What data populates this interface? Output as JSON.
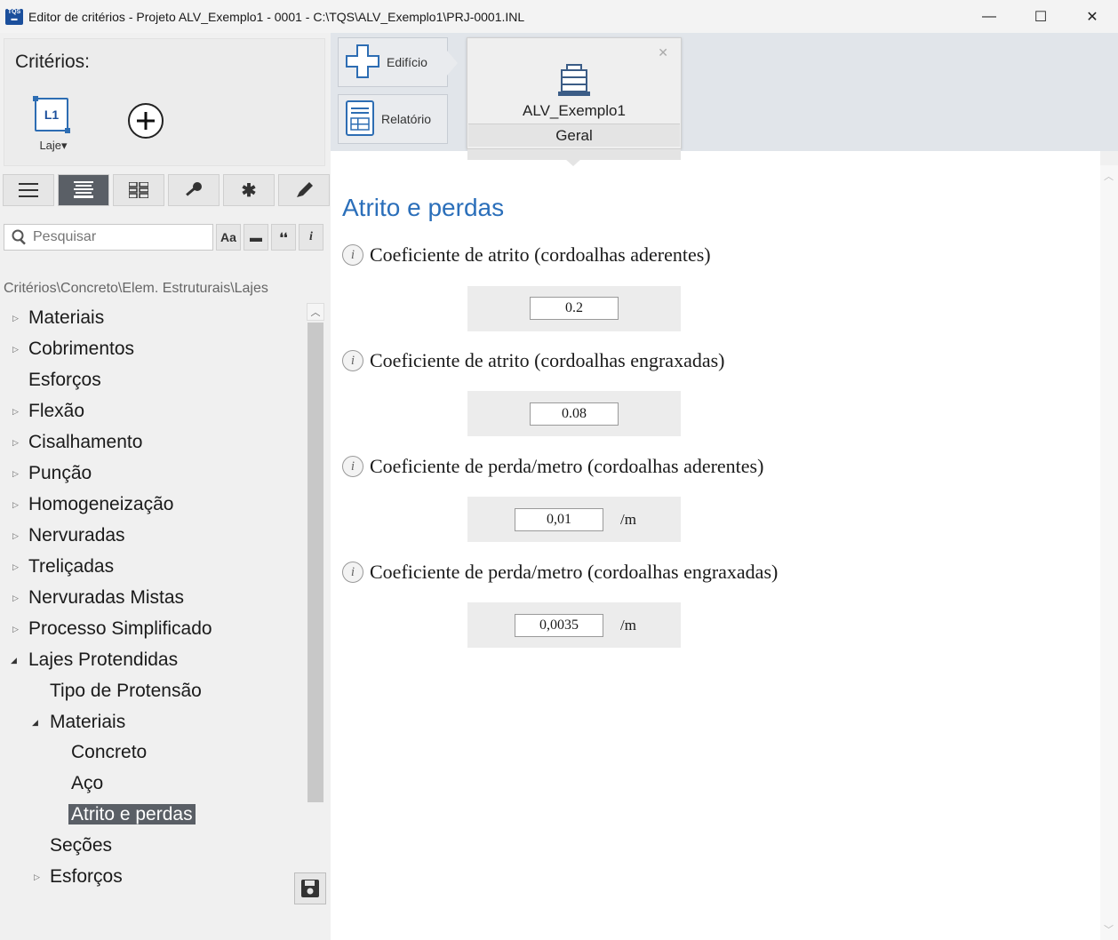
{
  "window": {
    "title": "Editor de critérios - Projeto ALV_Exemplo1 - 0001 - C:\\TQS\\ALV_Exemplo1\\PRJ-0001.INL",
    "app_icon_text_top": "TQS",
    "minimize": "—",
    "maximize": "☐",
    "close": "✕"
  },
  "left": {
    "criterios_label": "Critérios:",
    "laje_icon_text": "L1",
    "laje_caption": "Laje▾",
    "search_placeholder": "Pesquisar",
    "search_buttons": [
      "Aa",
      "▬",
      "❛❛",
      "i"
    ],
    "breadcrumb": "Critérios\\Concreto\\Elem. Estruturais\\Lajes",
    "tree": [
      {
        "label": "Materiais",
        "level": 0,
        "arrow": "▷"
      },
      {
        "label": "Cobrimentos",
        "level": 0,
        "arrow": "▷"
      },
      {
        "label": "Esforços",
        "level": 0,
        "arrow": ""
      },
      {
        "label": "Flexão",
        "level": 0,
        "arrow": "▷"
      },
      {
        "label": "Cisalhamento",
        "level": 0,
        "arrow": "▷"
      },
      {
        "label": "Punção",
        "level": 0,
        "arrow": "▷"
      },
      {
        "label": "Homogeneização",
        "level": 0,
        "arrow": "▷"
      },
      {
        "label": "Nervuradas",
        "level": 0,
        "arrow": "▷"
      },
      {
        "label": "Treliçadas",
        "level": 0,
        "arrow": "▷"
      },
      {
        "label": "Nervuradas Mistas",
        "level": 0,
        "arrow": "▷"
      },
      {
        "label": "Processo Simplificado",
        "level": 0,
        "arrow": "▷"
      },
      {
        "label": "Lajes Protendidas",
        "level": 0,
        "arrow": "◢"
      },
      {
        "label": "Tipo de Protensão",
        "level": 1,
        "arrow": ""
      },
      {
        "label": "Materiais",
        "level": 1,
        "arrow": "◢"
      },
      {
        "label": "Concreto",
        "level": 2,
        "arrow": ""
      },
      {
        "label": "Aço",
        "level": 2,
        "arrow": ""
      },
      {
        "label": "Atrito e perdas",
        "level": 2,
        "arrow": "",
        "selected": true
      },
      {
        "label": "Seções",
        "level": 1,
        "arrow": ""
      },
      {
        "label": "Esforços",
        "level": 1,
        "arrow": "▷"
      }
    ]
  },
  "nav": {
    "edificio": "Edifício",
    "relatorio": "Relatório"
  },
  "tab": {
    "name": "ALV_Exemplo1",
    "sub": "Geral",
    "close": "✕"
  },
  "content": {
    "title": "Atrito e perdas",
    "params": [
      {
        "label": "Coeficiente de atrito (cordoalhas aderentes)",
        "value": "0.2",
        "unit": ""
      },
      {
        "label": "Coeficiente de atrito (cordoalhas engraxadas)",
        "value": "0.08",
        "unit": ""
      },
      {
        "label": "Coeficiente de perda/metro (cordoalhas aderentes)",
        "value": "0,01",
        "unit": "/m"
      },
      {
        "label": "Coeficiente de perda/metro (cordoalhas engraxadas)",
        "value": "0,0035",
        "unit": "/m"
      }
    ]
  },
  "colors": {
    "title_blue": "#2b6fba",
    "selected_bg": "#5a5f66"
  }
}
